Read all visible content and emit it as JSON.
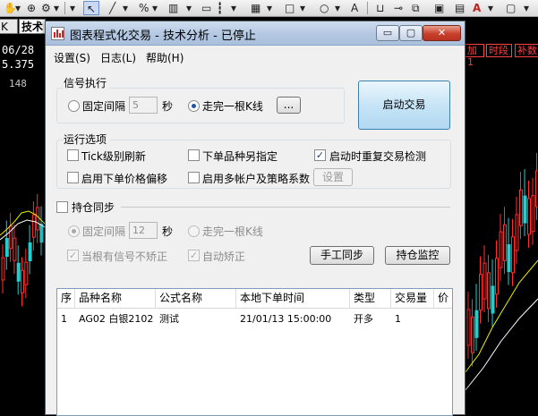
{
  "background": {
    "tabs": [
      "K线",
      "技术"
    ],
    "date_label": "06/28",
    "price_label": "5.375",
    "price2_label": "148",
    "right_tabs": [
      "加1",
      "时段",
      "补数"
    ],
    "toolbar_text_glyph": "A"
  },
  "window": {
    "title": "图表程式化交易 - 技术分析 - 已停止",
    "controls": {
      "minimize": "▭",
      "maximize": "▢",
      "close": "✕"
    }
  },
  "menu": [
    "设置(S)",
    "日志(L)",
    "帮助(H)"
  ],
  "signal": {
    "group_label": "信号执行",
    "fixed_interval_label": "固定间隔",
    "fixed_interval_value": "5",
    "unit": "秒",
    "bar_complete_label": "走完一根K线",
    "more_button": "...",
    "start_button": "启动交易"
  },
  "options": {
    "group_label": "运行选项",
    "tick_refresh": "Tick级别刷新",
    "order_other_contract": "下单品种另指定",
    "startup_recheck": "启动时重复交易检测",
    "price_offset": "启用下单价格偏移",
    "multi_account": "启用多帐户及策略系数",
    "settings_button": "设置"
  },
  "position_sync": {
    "label": "持仓同步",
    "fixed_interval_label": "固定间隔",
    "fixed_interval_value": "12",
    "unit": "秒",
    "bar_complete_label": "走完一根K线",
    "no_correct_with_signal": "当根有信号不矫正",
    "auto_correct": "自动矫正",
    "manual_sync_button": "手工同步",
    "monitor_button": "持仓监控"
  },
  "table": {
    "columns": [
      "序",
      "品种名称",
      "公式名称",
      "本地下单时间",
      "类型",
      "交易量",
      "价"
    ],
    "rows": [
      [
        "1",
        "AG02 白银2102",
        "测试",
        "21/01/13 15:00:00",
        "开多",
        "1",
        ""
      ]
    ]
  },
  "colors": {
    "up_candle": "#ff3030",
    "down_candle": "#20d0d0",
    "ma_yellow": "#f0f000",
    "ma_white": "#ffffff"
  }
}
